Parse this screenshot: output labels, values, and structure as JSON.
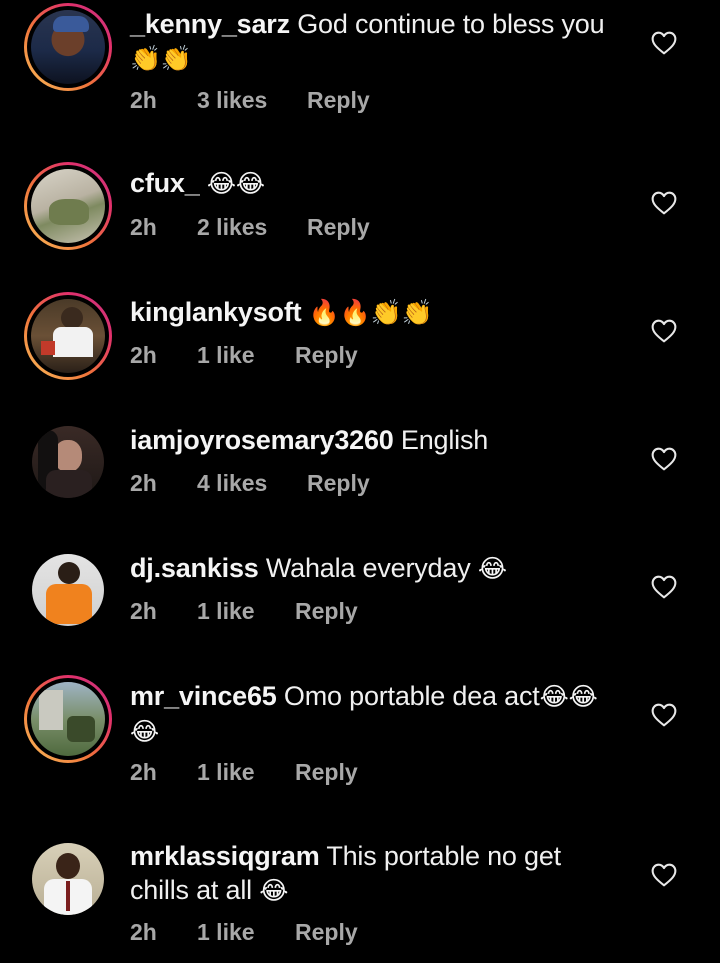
{
  "colors": {
    "background": "#000000",
    "text": "#f5f5f5",
    "meta_text": "#a8a8a8",
    "story_ring": [
      "#f9c05b",
      "#f0743a",
      "#e1306c",
      "#c13584"
    ]
  },
  "comments": [
    {
      "username": "_kenny_sarz",
      "text": "God continue to bless you",
      "emojis_line2": "👏👏",
      "time": "2h",
      "likes": "3 likes",
      "reply": "Reply",
      "story_ring": true,
      "icon": "heart-outline-icon"
    },
    {
      "username": "cfux_",
      "text": "",
      "emojis": "😂😂",
      "time": "2h",
      "likes": "2 likes",
      "reply": "Reply",
      "story_ring": true,
      "icon": "heart-outline-icon"
    },
    {
      "username": "kinglankysoft",
      "text": "",
      "emojis": "🔥🔥👏👏",
      "time": "2h",
      "likes": "1 like",
      "reply": "Reply",
      "story_ring": true,
      "icon": "heart-outline-icon"
    },
    {
      "username": "iamjoyrosemary3260",
      "text": "English",
      "time": "2h",
      "likes": "4 likes",
      "reply": "Reply",
      "story_ring": false,
      "icon": "heart-outline-icon"
    },
    {
      "username": "dj.sankiss",
      "text": "Wahala everyday",
      "emojis": "😂",
      "time": "2h",
      "likes": "1 like",
      "reply": "Reply",
      "story_ring": false,
      "icon": "heart-outline-icon"
    },
    {
      "username": "mr_vince65",
      "text": "Omo portable dea act",
      "emojis": "😂😂",
      "emojis_line2": "😂",
      "time": "2h",
      "likes": "1 like",
      "reply": "Reply",
      "story_ring": true,
      "icon": "heart-outline-icon"
    },
    {
      "username": "mrklassiqgram",
      "text": "This portable no get",
      "text_line2": "chills at all",
      "emojis_line2": "😂",
      "time": "2h",
      "likes": "1 like",
      "reply": "Reply",
      "story_ring": false,
      "icon": "heart-outline-icon"
    }
  ]
}
